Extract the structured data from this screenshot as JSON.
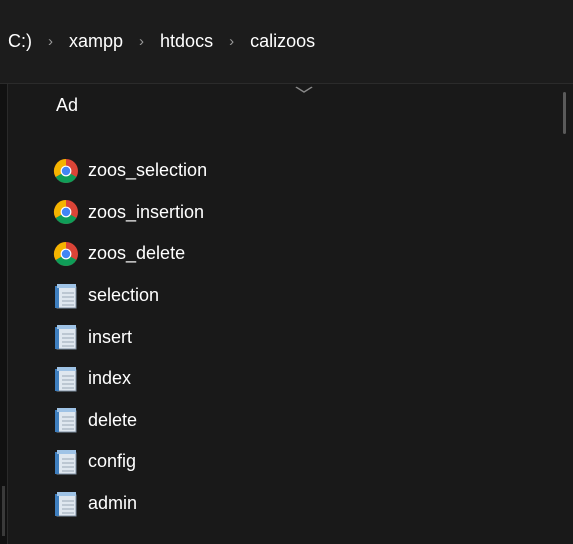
{
  "breadcrumb": {
    "items": [
      "C:)",
      "xampp",
      "htdocs",
      "calizoos"
    ],
    "separator": "›"
  },
  "header": {
    "column_label": "Ad"
  },
  "files": [
    {
      "name": "zoos_selection",
      "icon": "chrome-icon"
    },
    {
      "name": "zoos_insertion",
      "icon": "chrome-icon"
    },
    {
      "name": "zoos_delete",
      "icon": "chrome-icon"
    },
    {
      "name": "selection",
      "icon": "notepad-icon"
    },
    {
      "name": "insert",
      "icon": "notepad-icon"
    },
    {
      "name": "index",
      "icon": "notepad-icon"
    },
    {
      "name": "delete",
      "icon": "notepad-icon"
    },
    {
      "name": "config",
      "icon": "notepad-icon"
    },
    {
      "name": "admin",
      "icon": "notepad-icon"
    }
  ],
  "colors": {
    "background": "#191919",
    "text": "#ffffff",
    "separator": "#9a9a9a"
  }
}
